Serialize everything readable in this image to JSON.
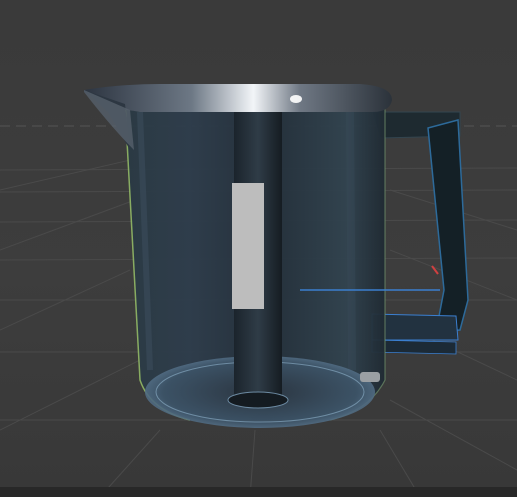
{
  "scene": {
    "background_color": "#3a3a3a",
    "grid_color": "#4a4a4a",
    "object": "kettle"
  },
  "kettle": {
    "body_tint": "#2b3a48",
    "rim_highlight": "#dfe6ee",
    "water_gauge_color": "#bdbdbd",
    "handle_color": "#1e2a30",
    "edge_glow": "#9fc96a",
    "base_color": "#5d7d96"
  },
  "gizmo": {
    "x_axis_color": "#d04040",
    "z_axis_color": "#3b7fd0"
  }
}
